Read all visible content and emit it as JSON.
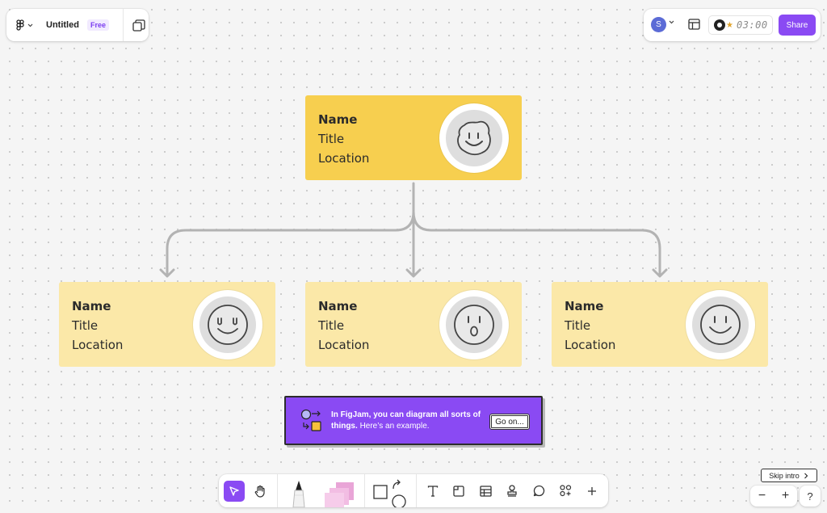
{
  "header": {
    "file_title": "Untitled",
    "plan_badge": "Free"
  },
  "topbar": {
    "avatar_initial": "S",
    "timer": "03:00",
    "share_label": "Share"
  },
  "org_chart": {
    "root": {
      "name": "Name",
      "title": "Title",
      "location": "Location"
    },
    "children": [
      {
        "name": "Name",
        "title": "Title",
        "location": "Location"
      },
      {
        "name": "Name",
        "title": "Title",
        "location": "Location"
      },
      {
        "name": "Name",
        "title": "Title",
        "location": "Location"
      }
    ]
  },
  "intro_banner": {
    "message_bold": "In FigJam, you can diagram all sorts of things.",
    "message_light": "Here’s an example.",
    "button_label": "Go on..."
  },
  "skip_label": "Skip intro",
  "zoom": {
    "out_label": "−",
    "in_label": "+"
  },
  "help_label": "?",
  "colors": {
    "accent": "#8a4af3",
    "root_card": "#f7cf4f",
    "child_card": "#fbe8a8",
    "connector": "#b3b3b3"
  },
  "icons": {
    "tools": [
      "select-icon",
      "hand-icon",
      "marker-icon",
      "sticky-notes-icon",
      "shapes-icon",
      "text-icon",
      "section-icon",
      "table-icon",
      "stamp-icon",
      "comment-icon",
      "widgets-icon",
      "plus-icon"
    ]
  }
}
